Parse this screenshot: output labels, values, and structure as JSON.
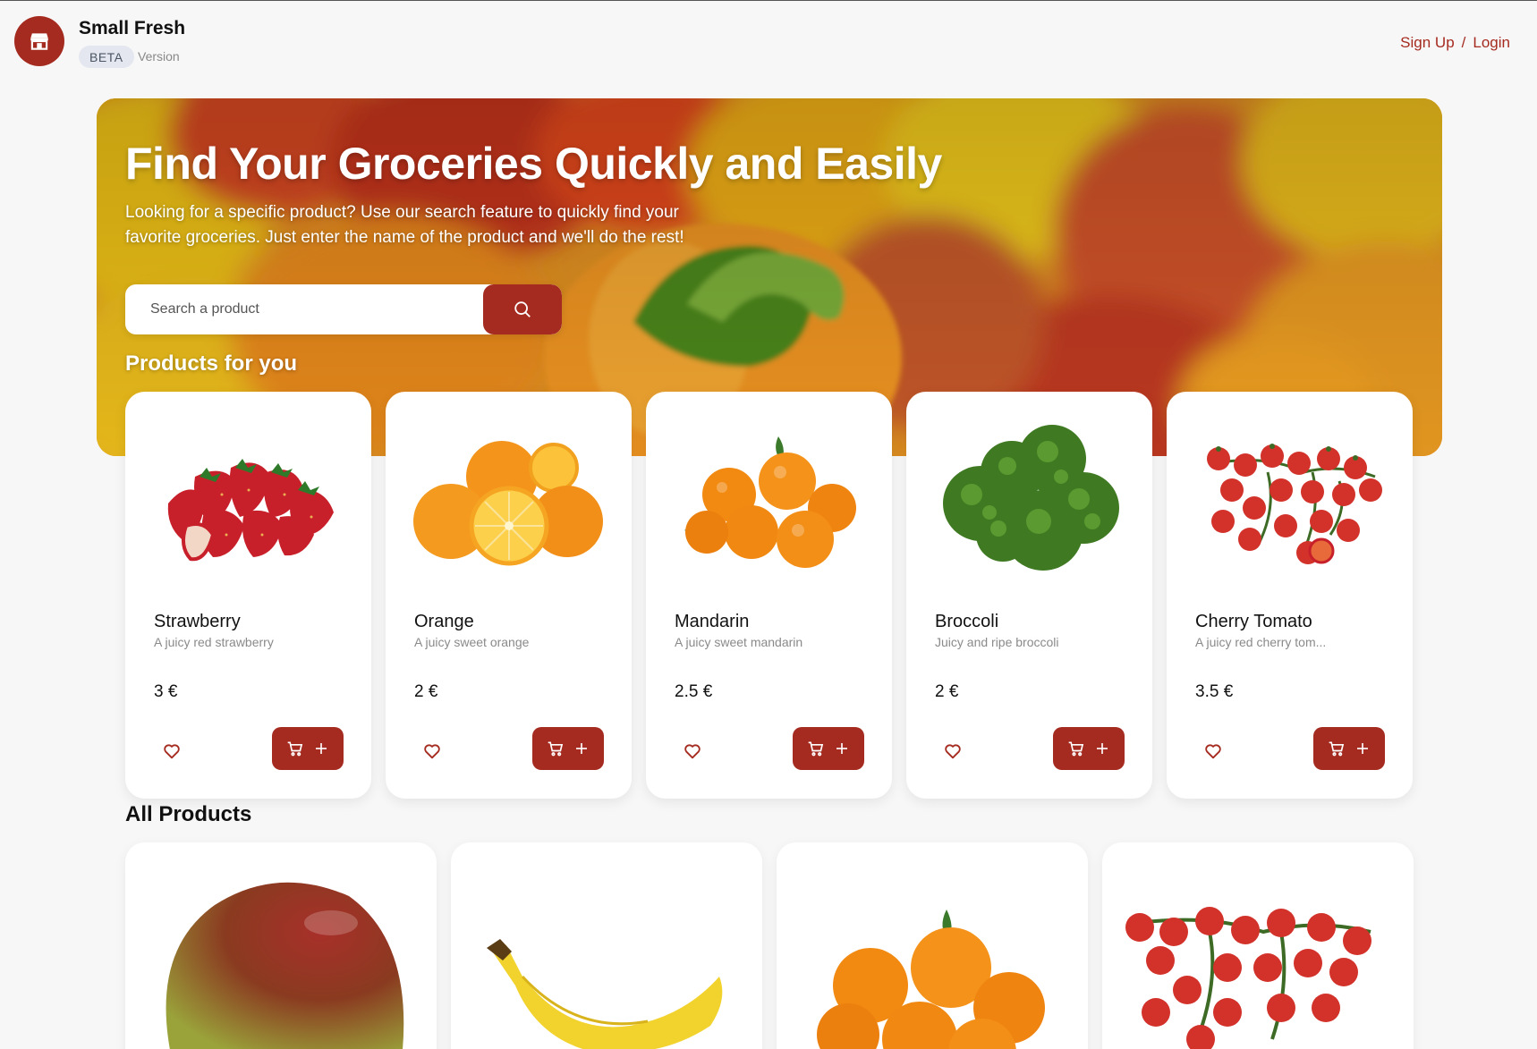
{
  "header": {
    "brand": "Small Fresh",
    "badge": "BETA",
    "version": "Version",
    "signup": "Sign Up",
    "separator": "/",
    "login": "Login",
    "logo_icon": "store-icon"
  },
  "hero": {
    "title": "Find Your Groceries Quickly and Easily",
    "subtitle": "Looking for a specific product? Use our search feature to quickly find your favorite groceries. Just enter the name of the product and we'll do the rest!",
    "search": {
      "placeholder": "Search a product",
      "button_icon": "search-icon"
    }
  },
  "sections": {
    "for_you": "Products for you",
    "all": "All Products"
  },
  "colors": {
    "accent": "#a52a1f",
    "background": "#f7f7f7",
    "card": "#ffffff"
  },
  "featured": [
    {
      "name": "Strawberry",
      "desc": "A juicy red strawberry",
      "price": "3 €",
      "image": "strawberry"
    },
    {
      "name": "Orange",
      "desc": "A juicy sweet orange",
      "price": "2 €",
      "image": "orange"
    },
    {
      "name": "Mandarin",
      "desc": "A juicy sweet mandarin",
      "price": "2.5 €",
      "image": "mandarin"
    },
    {
      "name": "Broccoli",
      "desc": "Juicy and ripe broccoli",
      "price": "2 €",
      "image": "broccoli"
    },
    {
      "name": "Cherry Tomato",
      "desc": "A juicy red cherry tom...",
      "price": "3.5 €",
      "image": "cherry-tomato"
    }
  ],
  "all_products": [
    {
      "image": "mango"
    },
    {
      "image": "banana"
    },
    {
      "image": "mandarin"
    },
    {
      "image": "cherry-tomato"
    }
  ]
}
